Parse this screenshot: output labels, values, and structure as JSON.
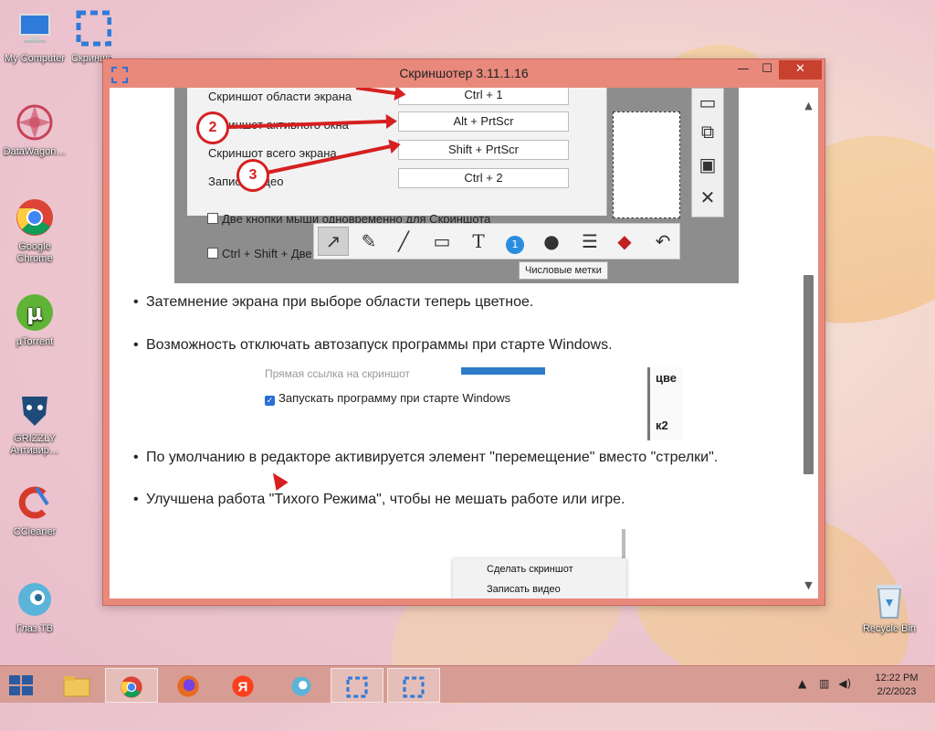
{
  "window": {
    "title": "Скриншотер 3.11.1.16",
    "minimize_symbol": "—",
    "maximize_symbol": "☐",
    "close_symbol": "✕",
    "accent_color": "#e8897c"
  },
  "desktop_icons": [
    {
      "label": "My Computer",
      "icon": "computer-icon"
    },
    {
      "label": "Скриншотер",
      "icon": "screenshoter-icon"
    },
    {
      "label": "DataWagon…",
      "icon": "datawagon-icon"
    },
    {
      "label": "Google Chrome",
      "icon": "chrome-icon"
    },
    {
      "label": "µTorrent",
      "icon": "utorrent-icon"
    },
    {
      "label": "GRIZZLY Антивир…",
      "icon": "grizzly-icon"
    },
    {
      "label": "CCleaner",
      "icon": "ccleaner-icon"
    },
    {
      "label": "Глаз.ТВ",
      "icon": "glaz-tv-icon"
    },
    {
      "label": "Recycle Bin",
      "icon": "recycle-bin-icon"
    }
  ],
  "shot1": {
    "rows": [
      {
        "label": "Скриншот области экрана",
        "key": "Ctrl + 1"
      },
      {
        "label": "Скриншот активного окна",
        "key": "Alt + PrtScr"
      },
      {
        "label": "Скриншот всего экрана",
        "key": "Shift + PrtScr"
      },
      {
        "label": "Запись видео",
        "key": "Ctrl + 2"
      }
    ],
    "checkbox1": "Две кнопки мыши одновременно для Скриншота",
    "checkbox2": "Ctrl + Shift + Две",
    "markers": [
      "2",
      "3"
    ],
    "tooltip": "Числовые метки",
    "tools": [
      "arrow",
      "pencil",
      "line",
      "rectangle",
      "text",
      "number",
      "blur",
      "menu",
      "color",
      "undo"
    ],
    "number_badge": "1"
  },
  "bullets": [
    "Затемнение экрана при выборе области теперь цветное.",
    "Возможность отключать автозапуск программы при старте Windows.",
    "По умолчанию в редакторе активируется элемент \"перемещение\" вместо \"стрелки\".",
    "Улучшена работа \"Тихого Режима\", чтобы не мешать работе или игре."
  ],
  "shot2": {
    "faded_text": "Прямая ссылка на скриншот",
    "checkbox_label": "Запускать программу при старте Windows",
    "right_strip_top": "цве",
    "right_strip_bottom": "к2"
  },
  "shot3": {
    "menu": [
      "Сделать скриншот",
      "Записать видео"
    ]
  },
  "taskbar": {
    "time": "12:22 PM",
    "date": "2/2/2023"
  }
}
